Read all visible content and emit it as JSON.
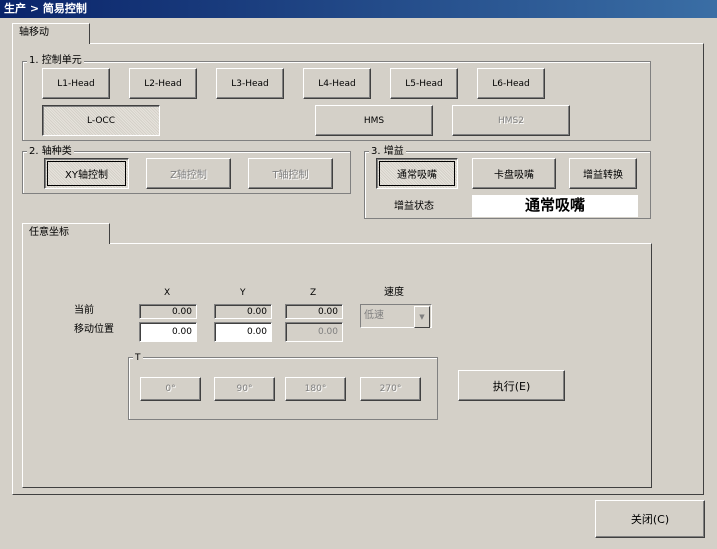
{
  "window": {
    "title": "生产 > 简易控制"
  },
  "tabs": {
    "axis_move": "轴移动",
    "coord": "任意坐标"
  },
  "control_unit": {
    "legend": "1. 控制单元",
    "heads": [
      "L1-Head",
      "L2-Head",
      "L3-Head",
      "L4-Head",
      "L5-Head",
      "L6-Head"
    ],
    "occ": "L-OCC",
    "hms": "HMS",
    "hms2": "HMS2"
  },
  "axis_type": {
    "legend": "2. 轴种类",
    "xy": "XY轴控制",
    "z": "Z轴控制",
    "t": "T轴控制"
  },
  "nozzle": {
    "legend": "3. 增益",
    "normal": "通常吸嘴",
    "disk": "卡盘吸嘴",
    "switch": "增益转换",
    "state_label": "增益状态",
    "state_value": "通常吸嘴"
  },
  "coord": {
    "col_x": "X",
    "col_y": "Y",
    "col_z": "Z",
    "col_speed": "速度",
    "row_current": "当前",
    "row_move": "移动位置",
    "current": {
      "x": "0.00",
      "y": "0.00",
      "z": "0.00"
    },
    "move": {
      "x": "0.00",
      "y": "0.00",
      "z": "0.00"
    },
    "speed": "低速",
    "t_legend": "T",
    "t_buttons": [
      "0°",
      "90°",
      "180°",
      "270°"
    ],
    "execute": "执行(E)"
  },
  "footer": {
    "close": "关闭(C)"
  }
}
